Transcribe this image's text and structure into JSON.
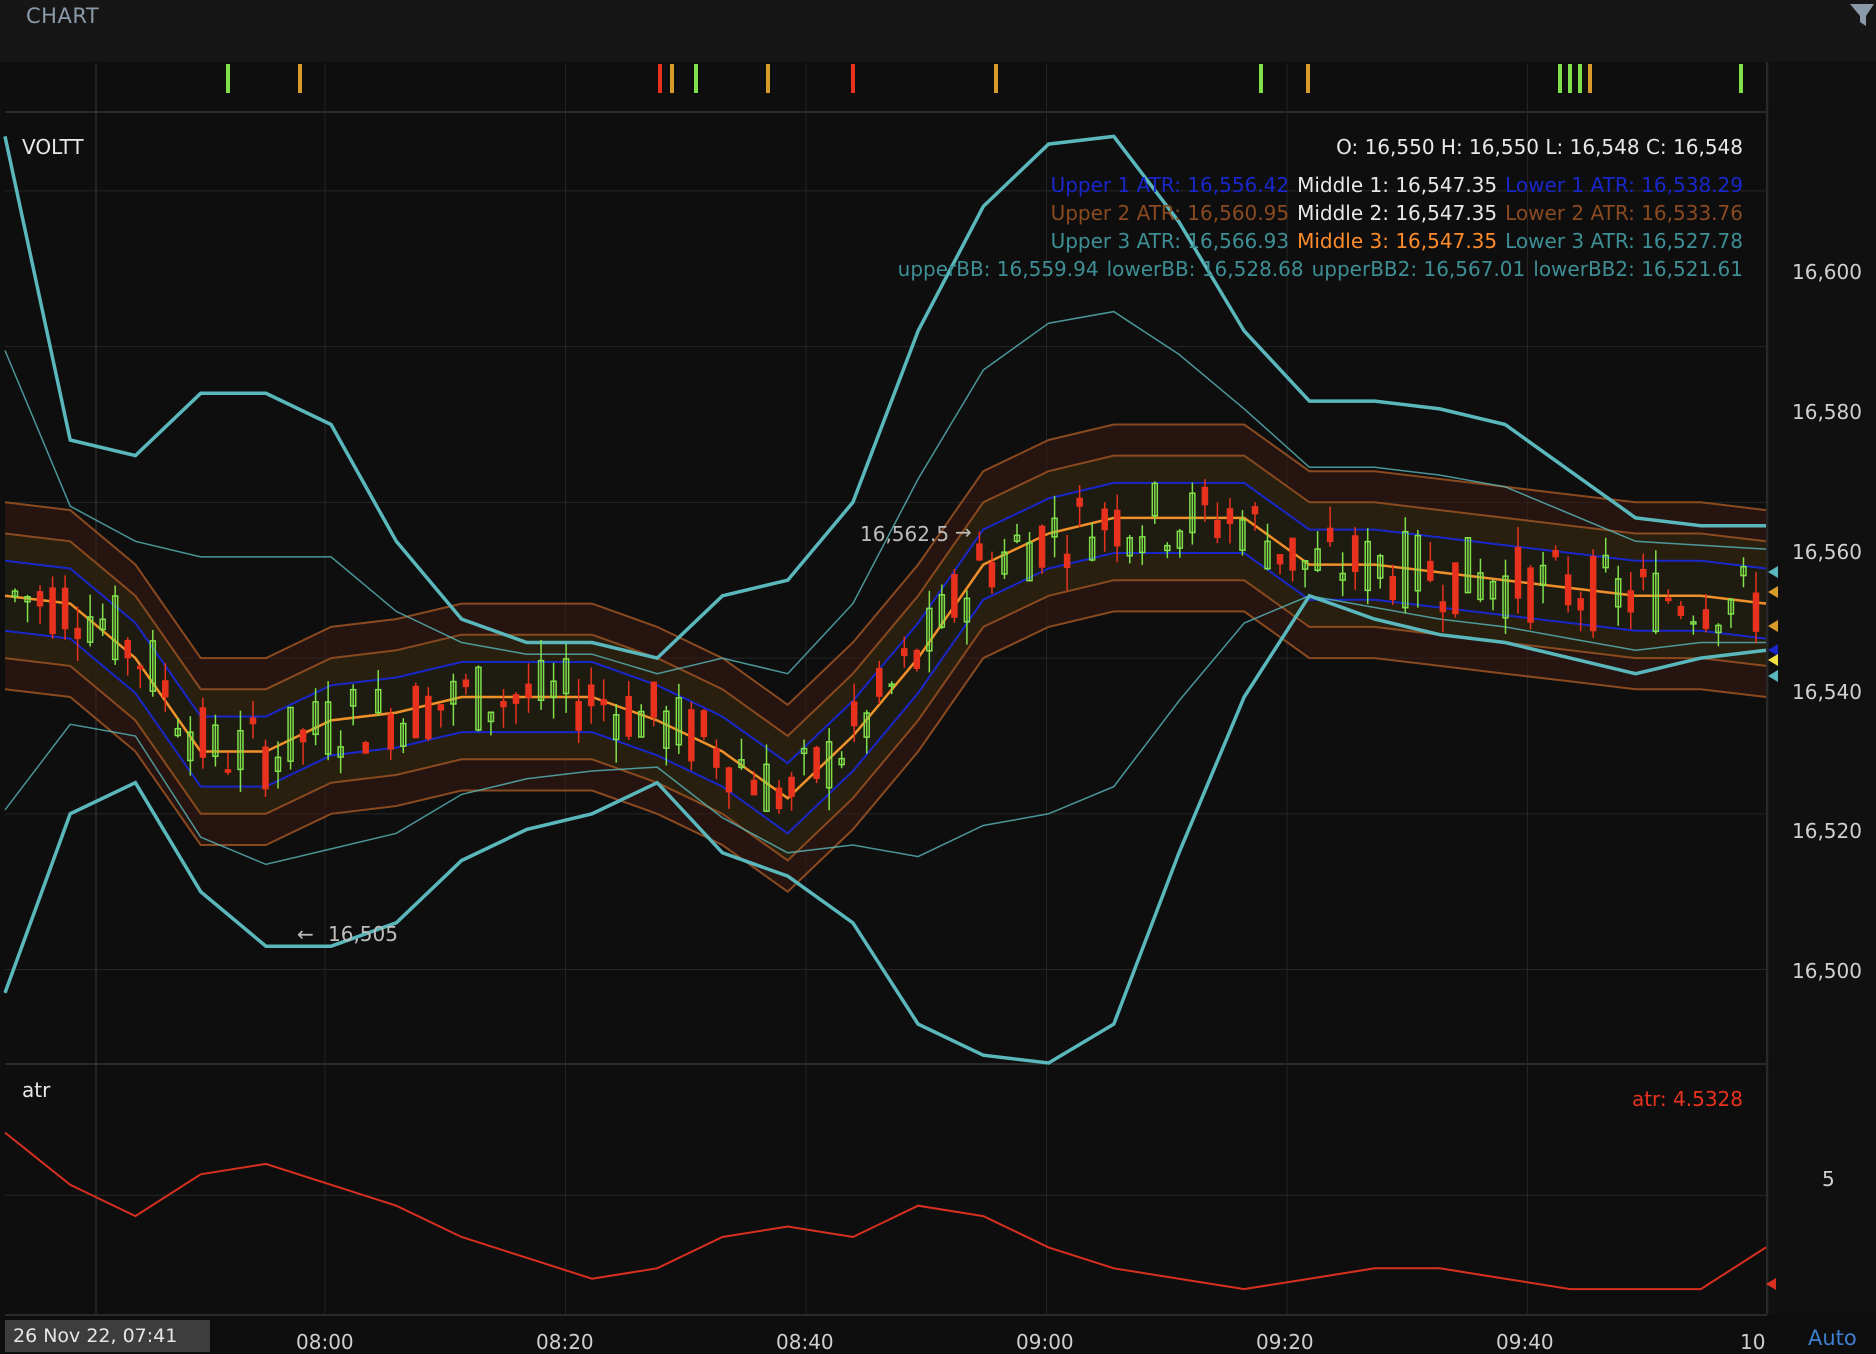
{
  "header": {
    "title": "CHART"
  },
  "main_pane": {
    "symbol": "VOLTT",
    "ohlc": "O: 16,550 H: 16,550 L: 16,548 C: 16,548",
    "legend_rows": [
      [
        {
          "text": "Upper 1 ATR: 16,556.42",
          "color": "#1a27c8"
        },
        {
          "text": "Middle 1: 16,547.35",
          "color": "#e8e8e8"
        },
        {
          "text": "Lower 1 ATR: 16,538.29",
          "color": "#1a27c8"
        }
      ],
      [
        {
          "text": "Upper 2 ATR: 16,560.95",
          "color": "#8a4a20"
        },
        {
          "text": "Middle 2: 16,547.35",
          "color": "#e8e8e8"
        },
        {
          "text": "Lower 2 ATR: 16,533.76",
          "color": "#8a4a20"
        }
      ],
      [
        {
          "text": "Upper 3 ATR: 16,566.93",
          "color": "#3e8f95"
        },
        {
          "text": "Middle 3: 16,547.35",
          "color": "#ff8c2a"
        },
        {
          "text": "Lower 3 ATR: 16,527.78",
          "color": "#3e8f95"
        }
      ],
      [
        {
          "text": "upperBB: 16,559.94",
          "color": "#3e8f95"
        },
        {
          "text": "lowerBB: 16,528.68",
          "color": "#3e8f95"
        },
        {
          "text": "upperBB2: 16,567.01",
          "color": "#3e8f95"
        },
        {
          "text": "lowerBB2: 16,521.61",
          "color": "#3e8f95"
        }
      ]
    ],
    "high_marker": "16,562.5",
    "low_marker": "16,505",
    "y_ticks": [
      "16,600",
      "16,580",
      "16,560",
      "16,540",
      "16,520",
      "16,500"
    ]
  },
  "atr_pane": {
    "label": "atr",
    "value_text": "atr: 4.5328",
    "y_ticks": [
      "5"
    ]
  },
  "x_axis": {
    "ticks": [
      "08:00",
      "08:20",
      "08:40",
      "09:00",
      "09:20",
      "09:40",
      "10"
    ],
    "crosshair_date": "26 Nov 22, 07:41",
    "auto_label": "Auto"
  },
  "colors": {
    "bull": "#7fe04a",
    "bear": "#e8321e",
    "middle": "#f0902a",
    "atr1": "#1a27c8",
    "atr2": "#8a4a20",
    "atr3": "#3e8f95",
    "bb": "#5ab8bc",
    "atr_line": "#d83020"
  },
  "chart_data": {
    "type": "line",
    "x": [
      "07:41",
      "07:45",
      "07:50",
      "07:55",
      "08:00",
      "08:05",
      "08:10",
      "08:15",
      "08:20",
      "08:25",
      "08:30",
      "08:35",
      "08:40",
      "08:45",
      "08:50",
      "08:55",
      "09:00",
      "09:05",
      "09:10",
      "09:15",
      "09:20",
      "09:25",
      "09:30",
      "09:35",
      "09:40",
      "09:45",
      "09:50",
      "09:55"
    ],
    "series": [
      {
        "name": "Middle 3",
        "values": [
          16548,
          16547,
          16540,
          16528,
          16528,
          16532,
          16533,
          16535,
          16535,
          16535,
          16532,
          16528,
          16522,
          16530,
          16540,
          16552,
          16556,
          16558,
          16558,
          16558,
          16552,
          16552,
          16551,
          16550,
          16549,
          16548,
          16548,
          16547
        ]
      },
      {
        "name": "upperBB2",
        "values": [
          16607,
          16568,
          16566,
          16574,
          16574,
          16570,
          16555,
          16545,
          16542,
          16542,
          16540,
          16548,
          16550,
          16560,
          16582,
          16598,
          16606,
          16607,
          16596,
          16582,
          16573,
          16573,
          16572,
          16570,
          16564,
          16558,
          16557,
          16557
        ]
      },
      {
        "name": "lowerBB2",
        "values": [
          16497,
          16520,
          16524,
          16510,
          16503,
          16503,
          16506,
          16514,
          16518,
          16520,
          16524,
          16515,
          16512,
          16506,
          16493,
          16489,
          16488,
          16493,
          16515,
          16535,
          16548,
          16545,
          16543,
          16542,
          16540,
          16538,
          16540,
          16541
        ]
      },
      {
        "name": "atr",
        "values": [
          5.6,
          5.1,
          4.8,
          5.2,
          5.3,
          5.1,
          4.9,
          4.6,
          4.4,
          4.2,
          4.3,
          4.6,
          4.7,
          4.6,
          4.9,
          4.8,
          4.5,
          4.3,
          4.2,
          4.1,
          4.2,
          4.3,
          4.3,
          4.2,
          4.1,
          4.1,
          4.1,
          4.5
        ]
      }
    ],
    "ylim": [
      16488,
      16610
    ]
  }
}
